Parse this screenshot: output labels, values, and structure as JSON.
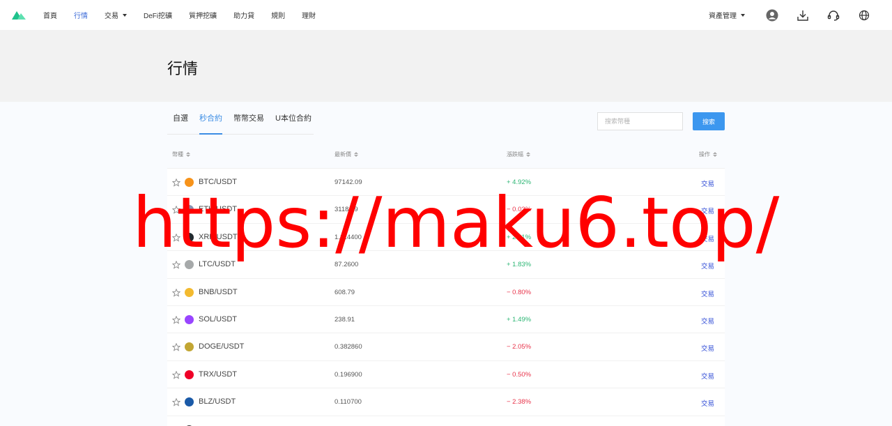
{
  "nav": {
    "items": [
      {
        "label": "首頁",
        "active": false,
        "dropdown": false
      },
      {
        "label": "行情",
        "active": true,
        "dropdown": false
      },
      {
        "label": "交易",
        "active": false,
        "dropdown": true
      },
      {
        "label": "DeFi挖礦",
        "active": false,
        "dropdown": false
      },
      {
        "label": "質押挖礦",
        "active": false,
        "dropdown": false
      },
      {
        "label": "助力貸",
        "active": false,
        "dropdown": false
      },
      {
        "label": "規則",
        "active": false,
        "dropdown": false
      },
      {
        "label": "理財",
        "active": false,
        "dropdown": false
      }
    ],
    "asset_menu": "資產管理",
    "icons": [
      "user-avatar-icon",
      "download-icon",
      "headset-icon",
      "globe-icon"
    ]
  },
  "page_title": "行情",
  "tabs": [
    {
      "label": "自選",
      "active": false
    },
    {
      "label": "秒合約",
      "active": true
    },
    {
      "label": "幣幣交易",
      "active": false
    },
    {
      "label": "U本位合約",
      "active": false
    }
  ],
  "search": {
    "placeholder": "搜索幣種",
    "button": "搜索"
  },
  "table": {
    "headers": {
      "coin": "幣種",
      "price": "最新價",
      "change": "漲跌幅",
      "action": "操作"
    },
    "rows": [
      {
        "pair": "BTC/USDT",
        "price": "97142.09",
        "change": "+ 4.92%",
        "dir": "up",
        "action": "交易",
        "coin_color": "#f7931a",
        "icon": "btc-icon"
      },
      {
        "pair": "ETH/USDT",
        "price": "3118.49",
        "change": "− 0.03%",
        "dir": "down",
        "action": "交易",
        "coin_color": "#8a92b2",
        "icon": "eth-icon"
      },
      {
        "pair": "XRP/USDT",
        "price": "1.114400",
        "change": "+ 2.21%",
        "dir": "up",
        "action": "交易",
        "coin_color": "#23292f",
        "icon": "xrp-icon"
      },
      {
        "pair": "LTC/USDT",
        "price": "87.2600",
        "change": "+ 1.83%",
        "dir": "up",
        "action": "交易",
        "coin_color": "#a6a9aa",
        "icon": "ltc-icon"
      },
      {
        "pair": "BNB/USDT",
        "price": "608.79",
        "change": "− 0.80%",
        "dir": "down",
        "action": "交易",
        "coin_color": "#f3ba2f",
        "icon": "bnb-icon"
      },
      {
        "pair": "SOL/USDT",
        "price": "238.91",
        "change": "+ 1.49%",
        "dir": "up",
        "action": "交易",
        "coin_color": "#9945ff",
        "icon": "sol-icon"
      },
      {
        "pair": "DOGE/USDT",
        "price": "0.382860",
        "change": "− 2.05%",
        "dir": "down",
        "action": "交易",
        "coin_color": "#c2a633",
        "icon": "doge-icon"
      },
      {
        "pair": "TRX/USDT",
        "price": "0.196900",
        "change": "− 0.50%",
        "dir": "down",
        "action": "交易",
        "coin_color": "#ef0027",
        "icon": "trx-icon"
      },
      {
        "pair": "BLZ/USDT",
        "price": "0.110700",
        "change": "− 2.38%",
        "dir": "down",
        "action": "交易",
        "coin_color": "#1a5aa8",
        "icon": "blz-icon"
      },
      {
        "pair": "",
        "price": "",
        "change": "",
        "dir": "down",
        "action": "",
        "coin_color": "#333333",
        "icon": "coin-icon"
      }
    ]
  },
  "watermark": "https://maku6.top/",
  "colors": {
    "accent": "#3c8de4",
    "up": "#2bb573",
    "down": "#e8334a",
    "trade_link": "#3a55d8",
    "logo": "#22c48a"
  }
}
